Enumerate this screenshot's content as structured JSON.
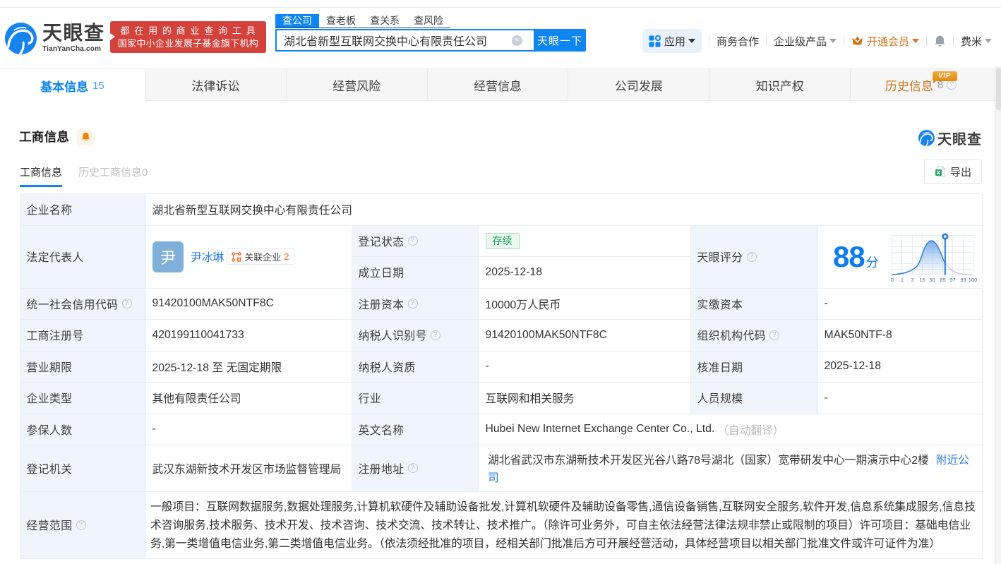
{
  "brand": {
    "name": "天眼查",
    "domain": "TianYanCha.com",
    "slogan_line1": "都在用的商业查询工具",
    "slogan_line2": "国家中小企业发展子基金旗下机构"
  },
  "search": {
    "tabs": [
      {
        "label": "查公司",
        "active": true
      },
      {
        "label": "查老板",
        "active": false
      },
      {
        "label": "查关系",
        "active": false
      },
      {
        "label": "查风险",
        "active": false
      }
    ],
    "query": "湖北省新型互联网交换中心有限责任公司",
    "clear_icon": "×",
    "submit_label": "天眼一下"
  },
  "topnav": {
    "apps": "应用",
    "biz_coop": "商务合作",
    "enterprise": "企业级产品",
    "vip": "开通会员",
    "username": "费米"
  },
  "nav_tabs": {
    "basic": "基本信息",
    "basic_count": "15",
    "legal": "法律诉讼",
    "risk": "经营风险",
    "operation": "经营信息",
    "development": "公司发展",
    "ip": "知识产权",
    "history": "历史信息",
    "history_count": "8",
    "vip_badge": "VIP",
    "help_mark": "?"
  },
  "section": {
    "title": "工商信息",
    "tab_current": "工商信息",
    "tab_history": "历史工商信息0",
    "export_label": "导出",
    "watermark": "天眼查"
  },
  "company": {
    "name_label": "企业名称",
    "name": "湖北省新型互联网交换中心有限责任公司",
    "legal_rep_label": "法定代表人",
    "legal_rep_avatar": "尹",
    "legal_rep_name": "尹冰琳",
    "related_tag": "关联企业",
    "related_count": "2",
    "reg_status_label": "登记状态",
    "reg_status": "存续",
    "establish_date_label": "成立日期",
    "establish_date": "2025-12-18",
    "score_label": "天眼评分",
    "score": "88",
    "score_unit": "分",
    "credit_code_label": "统一社会信用代码",
    "credit_code": "91420100MAK50NTF8C",
    "reg_capital_label": "注册资本",
    "reg_capital": "10000万人民币",
    "paid_capital_label": "实缴资本",
    "paid_capital": "-",
    "reg_number_label": "工商注册号",
    "reg_number": "420199110041733",
    "taxpayer_id_label": "纳税人识别号",
    "taxpayer_id": "91420100MAK50NTF8C",
    "org_code_label": "组织机构代码",
    "org_code": "MAK50NTF-8",
    "business_term_label": "营业期限",
    "business_term": "2025-12-18 至 无固定期限",
    "taxpayer_quality_label": "纳税人资质",
    "taxpayer_quality": "-",
    "approval_date_label": "核准日期",
    "approval_date": "2025-12-18",
    "company_type_label": "企业类型",
    "company_type": "其他有限责任公司",
    "industry_label": "行业",
    "industry": "互联网和相关服务",
    "staff_size_label": "人员规模",
    "staff_size": "-",
    "insured_label": "参保人数",
    "insured": "-",
    "english_name_label": "英文名称",
    "english_name": "Hubei New Internet Exchange Center Co., Ltd.",
    "english_name_note": "（自动翻译）",
    "reg_authority_label": "登记机关",
    "reg_authority": "武汉东湖新技术开发区市场监督管理局",
    "address_label": "注册地址",
    "address": "湖北省武汉市东湖新技术开发区光谷八路78号湖北（国家）宽带研发中心一期演示中心2楼",
    "address_link": "附近公司",
    "business_scope_label": "经营范围",
    "business_scope": "一般项目：互联网数据服务,数据处理服务,计算机软硬件及辅助设备批发,计算机软硬件及辅助设备零售,通信设备销售,互联网安全服务,软件开发,信息系统集成服务,信息技术咨询服务,技术服务、技术开发、技术咨询、技术交流、技术转让、技术推广。（除许可业务外，可自主依法经营法律法规非禁止或限制的项目）许可项目：基础电信业务,第一类增值电信业务,第二类增值电信业务。（依法须经批准的项目，经相关部门批准后方可开展经营活动，具体经营项目以相关部门批准文件或许可证件为准）"
  },
  "chart_data": {
    "type": "area",
    "title": "天眼评分",
    "score": 88,
    "ticks": [
      "0",
      "1",
      "3",
      "15",
      "50",
      "85",
      "97",
      "99",
      "100"
    ],
    "marker_value": 88,
    "peak_near_tick": "50",
    "legend_position": "none",
    "grid": true
  },
  "colors": {
    "brand_blue": "#0d85f2",
    "link_blue": "#2a7de1",
    "score_blue": "#0d7bf0",
    "slogan_red": "#d5413b",
    "vip_orange": "#d0761a",
    "tag_orange": "#f0641f",
    "label_bg": "#eff5fb",
    "table_border": "#e8eef4",
    "status_green": "#15a05c"
  }
}
